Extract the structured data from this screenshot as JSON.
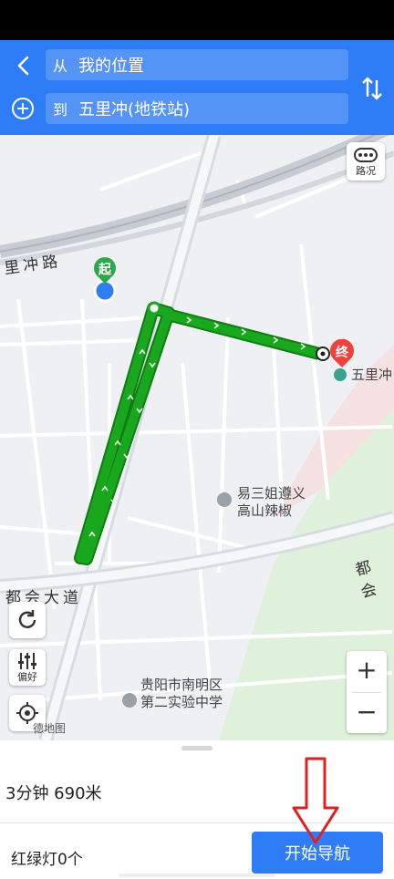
{
  "header": {
    "from_prefix": "从",
    "from_value": "我的位置",
    "to_prefix": "到",
    "to_value": "五里冲(地铁站)"
  },
  "map": {
    "road_labels": [
      "里冲路",
      "都会大道",
      "都会"
    ],
    "start_marker": "起",
    "end_marker": "终",
    "poi_dest": "五里冲",
    "poi_1": "易三姐遵义\n高山辣椒",
    "poi_2": "贵阳市南明区\n第二实验中学",
    "traffic_label": "路况",
    "preference_label": "偏好",
    "brand": "德地图"
  },
  "bottom": {
    "summary": "3分钟 690米",
    "traffic_lights": "红绿灯0个",
    "start_label": "开始导航"
  },
  "colors": {
    "accent": "#2f7df6",
    "route": "#19a81d",
    "marker_red": "#f0413c",
    "marker_green": "#2aa94a"
  }
}
